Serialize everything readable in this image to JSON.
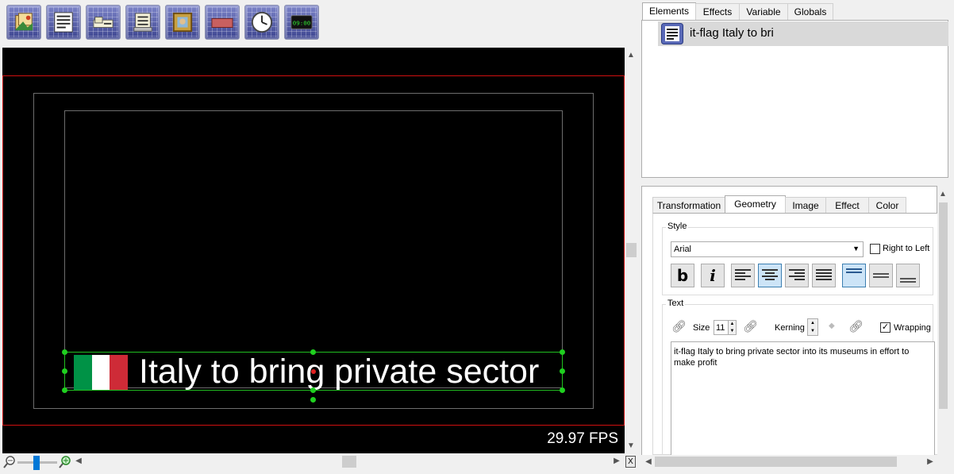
{
  "toolbar": {
    "buttons": [
      {
        "name": "images-folder-icon"
      },
      {
        "name": "text-document-icon"
      },
      {
        "name": "crawl-ticker-icon"
      },
      {
        "name": "scroll-text-icon"
      },
      {
        "name": "picture-frame-icon"
      },
      {
        "name": "color-bar-icon"
      },
      {
        "name": "analog-clock-icon"
      },
      {
        "name": "digital-clock-icon",
        "label": "09:00"
      }
    ]
  },
  "canvas": {
    "caption": "Italy to bring private sector",
    "fps": "29.97 FPS",
    "flag_colors": [
      "#009246",
      "#ffffff",
      "#ce2b37"
    ]
  },
  "elements_panel": {
    "tabs": [
      "Elements",
      "Effects",
      "Variable",
      "Globals"
    ],
    "active_tab": "Elements",
    "items": [
      {
        "label": "it-flag Italy to bri"
      }
    ]
  },
  "props_panel": {
    "tabs": [
      "Transformation",
      "Geometry",
      "Image",
      "Effect",
      "Color"
    ],
    "active_tab": "Geometry",
    "style_group": "Style",
    "font": "Arial",
    "right_to_left_label": "Right to Left",
    "bold_label": "b",
    "italic_label": "i",
    "text_group": "Text",
    "size_label": "Size",
    "size_value": "11",
    "kerning_label": "Kerning",
    "wrapping_label": "Wrapping",
    "wrapping_checked": true,
    "text_value": "it-flag Italy to bring private sector into its museums in effort to make profit"
  },
  "footer": {
    "close_label": "X"
  }
}
